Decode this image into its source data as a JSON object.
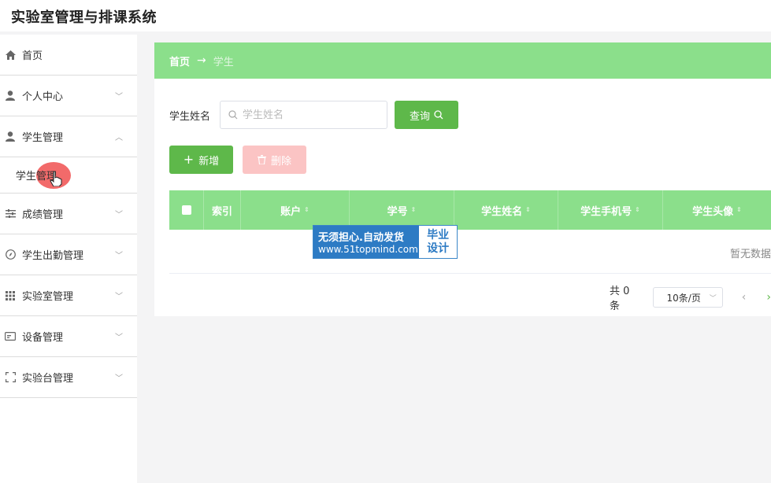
{
  "app": {
    "title": "实验室管理与排课系统"
  },
  "sidebar": {
    "items": [
      {
        "label": "首页",
        "icon": "home-icon"
      },
      {
        "label": "个人中心",
        "icon": "user-icon"
      },
      {
        "label": "学生管理",
        "icon": "user-icon",
        "submenu": "学生管理"
      },
      {
        "label": "成绩管理",
        "icon": "sliders-icon"
      },
      {
        "label": "学生出勤管理",
        "icon": "compass-icon"
      },
      {
        "label": "实验室管理",
        "icon": "grid-icon"
      },
      {
        "label": "设备管理",
        "icon": "card-icon"
      },
      {
        "label": "实验台管理",
        "icon": "frame-icon"
      }
    ]
  },
  "breadcrumb": {
    "home": "首页",
    "arrow": "→",
    "current": "学生"
  },
  "search": {
    "label": "学生姓名",
    "placeholder": "学生姓名",
    "button": "查询"
  },
  "actions": {
    "add": "新增",
    "delete": "删除"
  },
  "table": {
    "columns": [
      "索引",
      "账户",
      "学号",
      "学生姓名",
      "学生手机号",
      "学生头像"
    ],
    "empty_text": "暂无数据"
  },
  "pagination": {
    "total": "共 0 条",
    "page_size": "10条/页"
  },
  "watermark": {
    "line1": "无须担心.自动发货",
    "line2": "www.51topmind.com",
    "right1": "毕业",
    "right2": "设计"
  },
  "colors": {
    "accent": "#8bdf8b",
    "button": "#5eb84a",
    "danger_disabled": "#fbc4c4"
  }
}
